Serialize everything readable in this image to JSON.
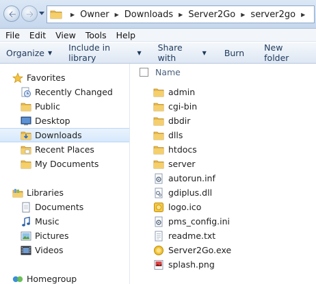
{
  "address_bar": {
    "breadcrumbs": [
      "Owner",
      "Downloads",
      "Server2Go",
      "server2go"
    ],
    "back_icon": "back-arrow-icon",
    "forward_icon": "forward-arrow-icon"
  },
  "menu": [
    "File",
    "Edit",
    "View",
    "Tools",
    "Help"
  ],
  "command_bar": {
    "organize": "Organize",
    "include_in_library": "Include in library",
    "share_with": "Share with",
    "burn": "Burn",
    "new_folder": "New folder"
  },
  "nav": {
    "favorites": {
      "label": "Favorites",
      "items": [
        "Recently Changed",
        "Public",
        "Desktop",
        "Downloads",
        "Recent Places",
        "My Documents"
      ]
    },
    "libraries": {
      "label": "Libraries",
      "items": [
        "Documents",
        "Music",
        "Pictures",
        "Videos"
      ]
    },
    "homegroup": "Homegroup",
    "selected": "Downloads"
  },
  "file_list": {
    "column_name": "Name",
    "files": [
      {
        "name": "admin",
        "type": "folder"
      },
      {
        "name": "cgi-bin",
        "type": "folder"
      },
      {
        "name": "dbdir",
        "type": "folder"
      },
      {
        "name": "dlls",
        "type": "folder"
      },
      {
        "name": "htdocs",
        "type": "folder"
      },
      {
        "name": "server",
        "type": "folder"
      },
      {
        "name": "autorun.inf",
        "type": "config"
      },
      {
        "name": "gdiplus.dll",
        "type": "dll"
      },
      {
        "name": "logo.ico",
        "type": "ico"
      },
      {
        "name": "pms_config.ini",
        "type": "config"
      },
      {
        "name": "readme.txt",
        "type": "text"
      },
      {
        "name": "Server2Go.exe",
        "type": "exe"
      },
      {
        "name": "splash.png",
        "type": "image"
      }
    ]
  },
  "colors": {
    "folder": "#e8b84a",
    "selection": "#d6e8fb",
    "command_text": "#1e395b"
  }
}
